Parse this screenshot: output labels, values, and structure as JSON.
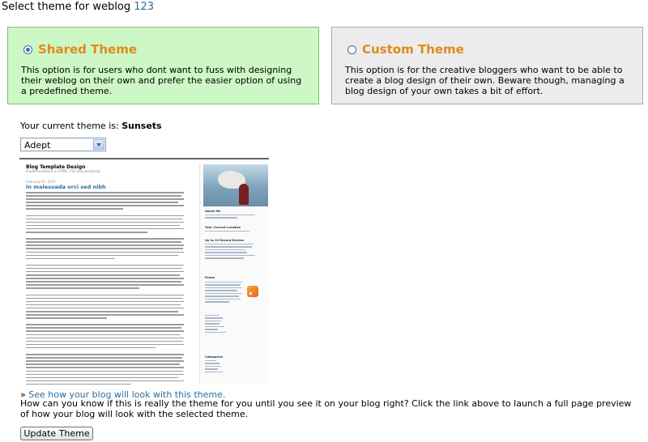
{
  "page": {
    "title_prefix": "Select theme for weblog",
    "blog_name": "123"
  },
  "themes": [
    {
      "name": "Shared Theme",
      "selected": true,
      "description": "This option is for users who dont want to fuss with designing their weblog on their own and prefer the easier option of using a predefined theme."
    },
    {
      "name": "Custom Theme",
      "selected": false,
      "description": "This option is for the creative bloggers who want to be able to create a blog design of their own. Beware though, managing a blog design of your own takes a bit of effort."
    }
  ],
  "current_theme": {
    "label": "Your current theme is:",
    "name": "Sunsets"
  },
  "theme_select": {
    "value": "Adept"
  },
  "preview": {
    "blog_title": "Blog Template Design",
    "subtitle": "Implementations in HTML, CSS and JavaScript",
    "post_date": "February 07, 2007",
    "post_title": "In malesuada orci sed nibh",
    "sidebar_headings": [
      "About Me",
      "Your Current Location",
      "Up to 10 Recent Entries",
      "Feeds",
      "Categories"
    ]
  },
  "preview_link": {
    "prefix": "»",
    "label": "See how your blog will look with this theme."
  },
  "help_text": "How can you know if this is really the theme for you until you see it on your blog right? Click the link above to launch a full page preview of how your blog will look with the selected theme.",
  "update_button": {
    "label": "Update Theme"
  },
  "colors": {
    "shared_bg": "#cdf7c4",
    "custom_bg": "#ececec",
    "theme_title": "#e08a1a",
    "link": "#2a6ea1"
  }
}
